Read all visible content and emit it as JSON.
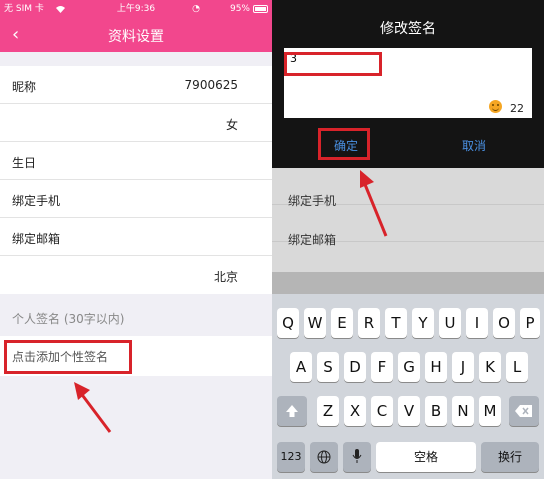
{
  "left": {
    "status_bar": {
      "carrier": "无 SIM 卡",
      "time": "上午9:36",
      "battery": "95%"
    },
    "nav": {
      "back": "‹",
      "title": "资料设置"
    },
    "rows": [
      {
        "label": "昵称",
        "value": "7900625"
      },
      {
        "label": "",
        "value": "女"
      },
      {
        "label": "生日",
        "value": ""
      },
      {
        "label": "绑定手机",
        "value": ""
      },
      {
        "label": "绑定邮箱",
        "value": ""
      },
      {
        "label": "",
        "value": "北京"
      }
    ],
    "signature_header": "个人签名 (30字以内)",
    "signature_placeholder": "点击添加个性签名"
  },
  "right": {
    "dialog": {
      "title": "修改签名",
      "typed": "3",
      "counter": "22",
      "confirm": "确定",
      "cancel": "取消"
    },
    "rows": [
      {
        "label": "绑定手机"
      },
      {
        "label": "绑定邮箱"
      }
    ],
    "keyboard": {
      "row1": [
        "Q",
        "W",
        "E",
        "R",
        "T",
        "Y",
        "U",
        "I",
        "O",
        "P"
      ],
      "row2": [
        "A",
        "S",
        "D",
        "F",
        "G",
        "H",
        "J",
        "K",
        "L"
      ],
      "row3": [
        "Z",
        "X",
        "C",
        "V",
        "B",
        "N",
        "M"
      ],
      "numbers": "123",
      "space": "空格",
      "return": "换行"
    }
  },
  "colors": {
    "accent": "#f2478d",
    "highlight": "#d8232a",
    "link": "#4a90e2"
  }
}
